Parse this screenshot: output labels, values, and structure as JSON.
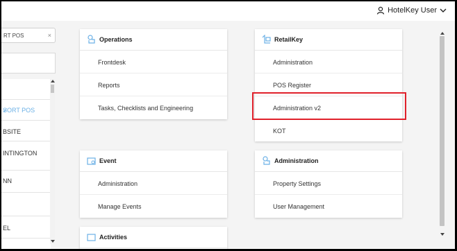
{
  "header": {
    "user_label": "HotelKey User"
  },
  "left_panel": {
    "filter_text": "RT POS",
    "filter_clear": "×",
    "items": [
      {
        "label": ""
      },
      {
        "label": "SORT POS",
        "selected": true
      },
      {
        "label": "BSITE"
      },
      {
        "label": "INTINGTON"
      },
      {
        "label": "NN"
      },
      {
        "label": ""
      },
      {
        "label": "EL"
      }
    ],
    "check_mark": "✓"
  },
  "cards": {
    "operations": {
      "title": "Operations",
      "items": [
        "Frontdesk",
        "Reports",
        "Tasks, Checklists and Engineering"
      ]
    },
    "retailkey": {
      "title": "RetailKey",
      "items": [
        "Administration",
        "POS Register",
        "Administration v2",
        "KOT"
      ]
    },
    "event": {
      "title": "Event",
      "items": [
        "Administration",
        "Manage Events"
      ]
    },
    "administration": {
      "title": "Administration",
      "items": [
        "Property Settings",
        "User Management"
      ]
    },
    "activities": {
      "title": "Activities"
    }
  },
  "accent_color": "#6bb0e6",
  "highlight_color": "#e0202a"
}
